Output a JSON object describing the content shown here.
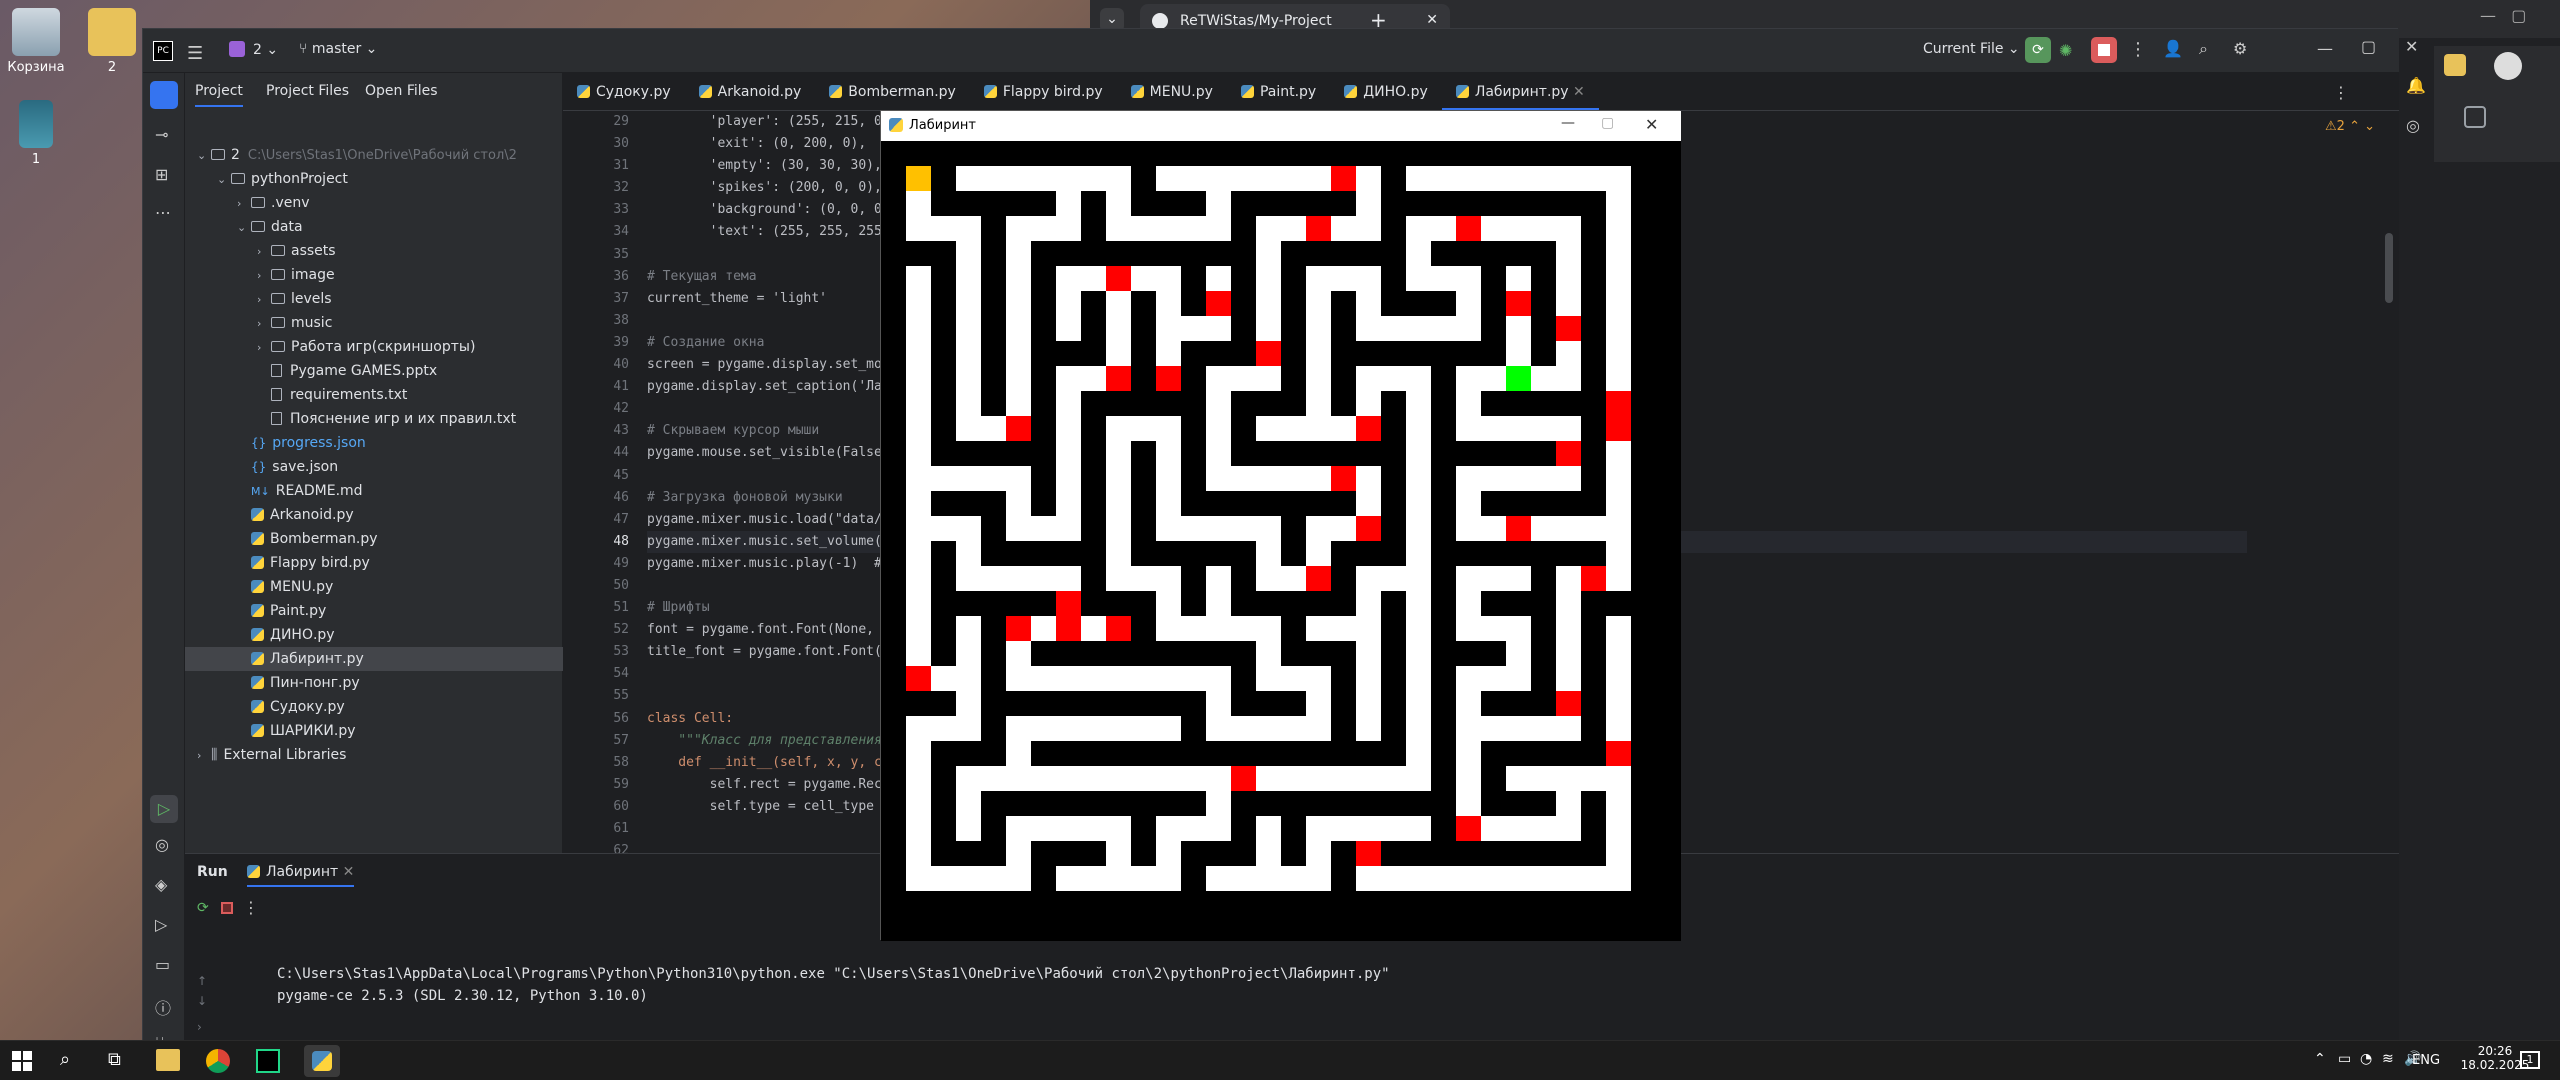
{
  "desktop": {
    "icons": [
      {
        "label": "Корзина"
      },
      {
        "label": "2"
      },
      {
        "label": "1"
      }
    ]
  },
  "browser": {
    "tab_title": "ReTWiStas/My-Project",
    "new_tab": "+"
  },
  "ide": {
    "project_name": "2",
    "branch": "master",
    "run_config": "Current File",
    "project_tabs": [
      "Project",
      "Project Files",
      "Open Files"
    ],
    "tree": [
      {
        "indent": 0,
        "type": "folder",
        "label": "2",
        "extra": "C:\\Users\\Stas1\\OneDrive\\Рабочий стол\\2",
        "chev": "v"
      },
      {
        "indent": 1,
        "type": "folder",
        "label": "pythonProject",
        "chev": "v"
      },
      {
        "indent": 2,
        "type": "folder",
        "label": ".venv",
        "chev": ">"
      },
      {
        "indent": 2,
        "type": "folder",
        "label": "data",
        "chev": "v"
      },
      {
        "indent": 3,
        "type": "folder",
        "label": "assets",
        "chev": ">"
      },
      {
        "indent": 3,
        "type": "folder",
        "label": "image",
        "chev": ">"
      },
      {
        "indent": 3,
        "type": "folder",
        "label": "levels",
        "chev": ">"
      },
      {
        "indent": 3,
        "type": "folder",
        "label": "music",
        "chev": ">"
      },
      {
        "indent": 3,
        "type": "folder",
        "label": "Работа игр(скриншорты)",
        "chev": ">"
      },
      {
        "indent": 3,
        "type": "file",
        "label": "Pygame GAMES.pptx"
      },
      {
        "indent": 3,
        "type": "file",
        "label": "requirements.txt"
      },
      {
        "indent": 3,
        "type": "file",
        "label": "Пояснение игр и их правил.txt"
      },
      {
        "indent": 2,
        "type": "json",
        "label": "progress.json"
      },
      {
        "indent": 2,
        "type": "json",
        "label": "save.json"
      },
      {
        "indent": 2,
        "type": "md",
        "label": "README.md"
      },
      {
        "indent": 2,
        "type": "py",
        "label": "Arkanoid.py"
      },
      {
        "indent": 2,
        "type": "py",
        "label": "Bomberman.py"
      },
      {
        "indent": 2,
        "type": "py",
        "label": "Flappy bird.py"
      },
      {
        "indent": 2,
        "type": "py",
        "label": "MENU.py"
      },
      {
        "indent": 2,
        "type": "py",
        "label": "Paint.py"
      },
      {
        "indent": 2,
        "type": "py",
        "label": "ДИНО.py"
      },
      {
        "indent": 2,
        "type": "py",
        "label": "Лабиринт.py",
        "selected": true
      },
      {
        "indent": 2,
        "type": "py",
        "label": "Пин-понг.py"
      },
      {
        "indent": 2,
        "type": "py",
        "label": "Судоку.py"
      },
      {
        "indent": 2,
        "type": "py",
        "label": "ШАРИКИ.py"
      },
      {
        "indent": 0,
        "type": "lib",
        "label": "External Libraries",
        "chev": ">"
      }
    ],
    "editor_tabs": [
      "Судоку.py",
      "Arkanoid.py",
      "Bomberman.py",
      "Flappy bird.py",
      "MENU.py",
      "Paint.py",
      "ДИНО.py",
      "Лабиринт.py"
    ],
    "active_tab": "Лабиринт.py",
    "warnings": "2",
    "line_numbers": [
      "29",
      "30",
      "31",
      "32",
      "33",
      "34",
      "35",
      "36",
      "37",
      "38",
      "39",
      "40",
      "41",
      "42",
      "43",
      "44",
      "45",
      "46",
      "47",
      "48",
      "49",
      "50",
      "51",
      "52",
      "53",
      "54",
      "55",
      "56",
      "57",
      "58",
      "59",
      "60",
      "61",
      "62"
    ],
    "code_lines": [
      "        'player': (255, 215, 0),",
      "        'exit': (0, 200, 0),",
      "        'empty': (30, 30, 30),",
      "        'spikes': (200, 0, 0),",
      "        'background': (0, 0, 0),",
      "        'text': (255, 255, 255",
      "",
      "# Текущая тема",
      "current_theme = 'light'",
      "",
      "# Создание окна",
      "screen = pygame.display.set_mo",
      "pygame.display.set_caption('Ла",
      "",
      "# Скрываем курсор мыши",
      "pygame.mouse.set_visible(False",
      "",
      "# Загрузка фоновой музыки",
      "pygame.mixer.music.load(\"data/",
      "pygame.mixer.music.set_volume(",
      "pygame.mixer.music.play(-1)  #",
      "",
      "# Шрифты",
      "font = pygame.font.Font(None, ",
      "title_font = pygame.font.Font(",
      "",
      "",
      "class Cell:",
      "    \"\"\"Класс для представления",
      "    def __init__(self, x, y, c",
      "        self.rect = pygame.Rec",
      "        self.type = cell_type",
      "",
      ""
    ],
    "run": {
      "tab_label": "Run",
      "config_tab": "Лабиринт",
      "output": [
        "C:\\Users\\Stas1\\AppData\\Local\\Programs\\Python\\Python310\\python.exe \"C:\\Users\\Stas1\\OneDrive\\Рабочий стол\\2\\pythonProject\\Лабиринт.py\"",
        "pygame-ce 2.5.3 (SDL 2.30.12, Python 3.10.0)"
      ]
    }
  },
  "game": {
    "title": "Лабиринт",
    "colors": {
      "wall": "#000000",
      "floor": "#ffffff",
      "spike": "#ff0000",
      "exit": "#00ff00",
      "player": "#ffc000"
    }
  },
  "taskbar": {
    "lang": "ENG",
    "time": "20:26",
    "date": "18.02.2025",
    "notif_count": "1"
  }
}
